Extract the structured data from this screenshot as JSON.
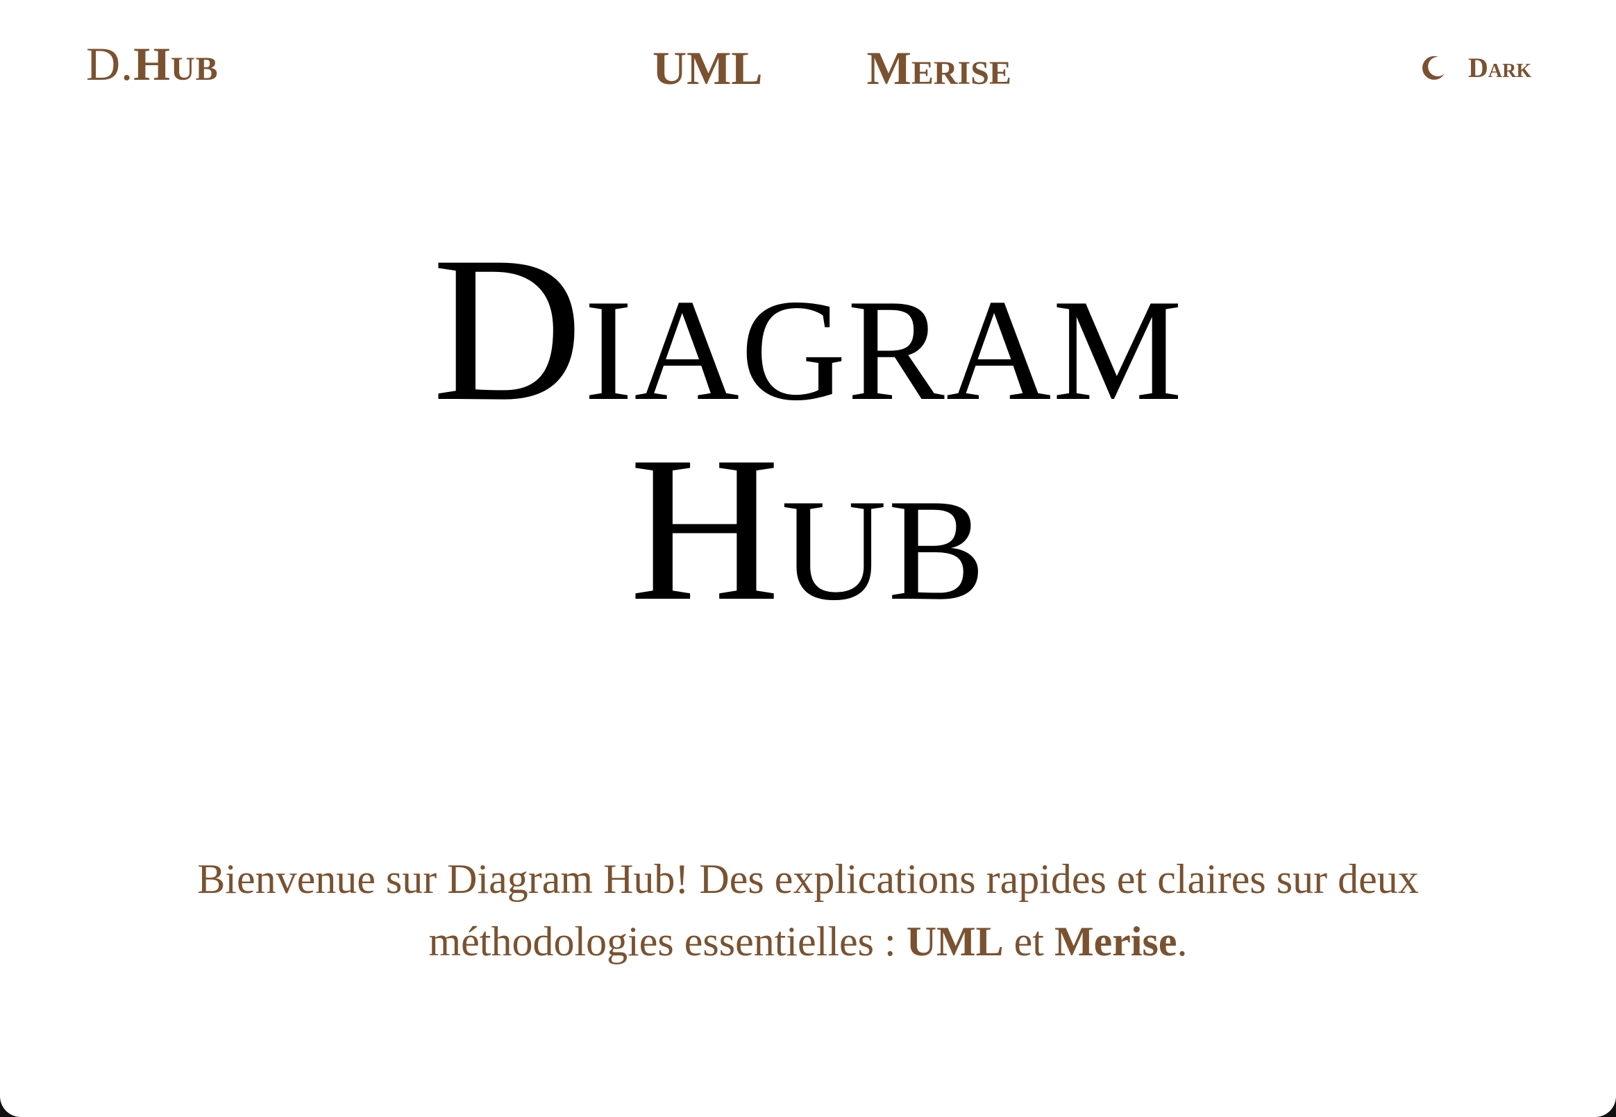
{
  "nav": {
    "brand_prefix": "D.",
    "brand_name": "Hub",
    "links": [
      {
        "label": "UML"
      },
      {
        "label": "Merise"
      }
    ],
    "theme_toggle_label": "Dark",
    "theme_icon": "moon-icon"
  },
  "hero": {
    "line1": "Diagram",
    "line2": "Hub"
  },
  "intro": {
    "text_before": "Bienvenue sur Diagram Hub! Des explications rapides et claires sur deux méthodologies essentielles : ",
    "term1": "UML",
    "text_middle": " et ",
    "term2": "Merise",
    "text_after": "."
  },
  "colors": {
    "accent": "#7a5230",
    "background": "#ffffff",
    "hero_text": "#000000"
  }
}
